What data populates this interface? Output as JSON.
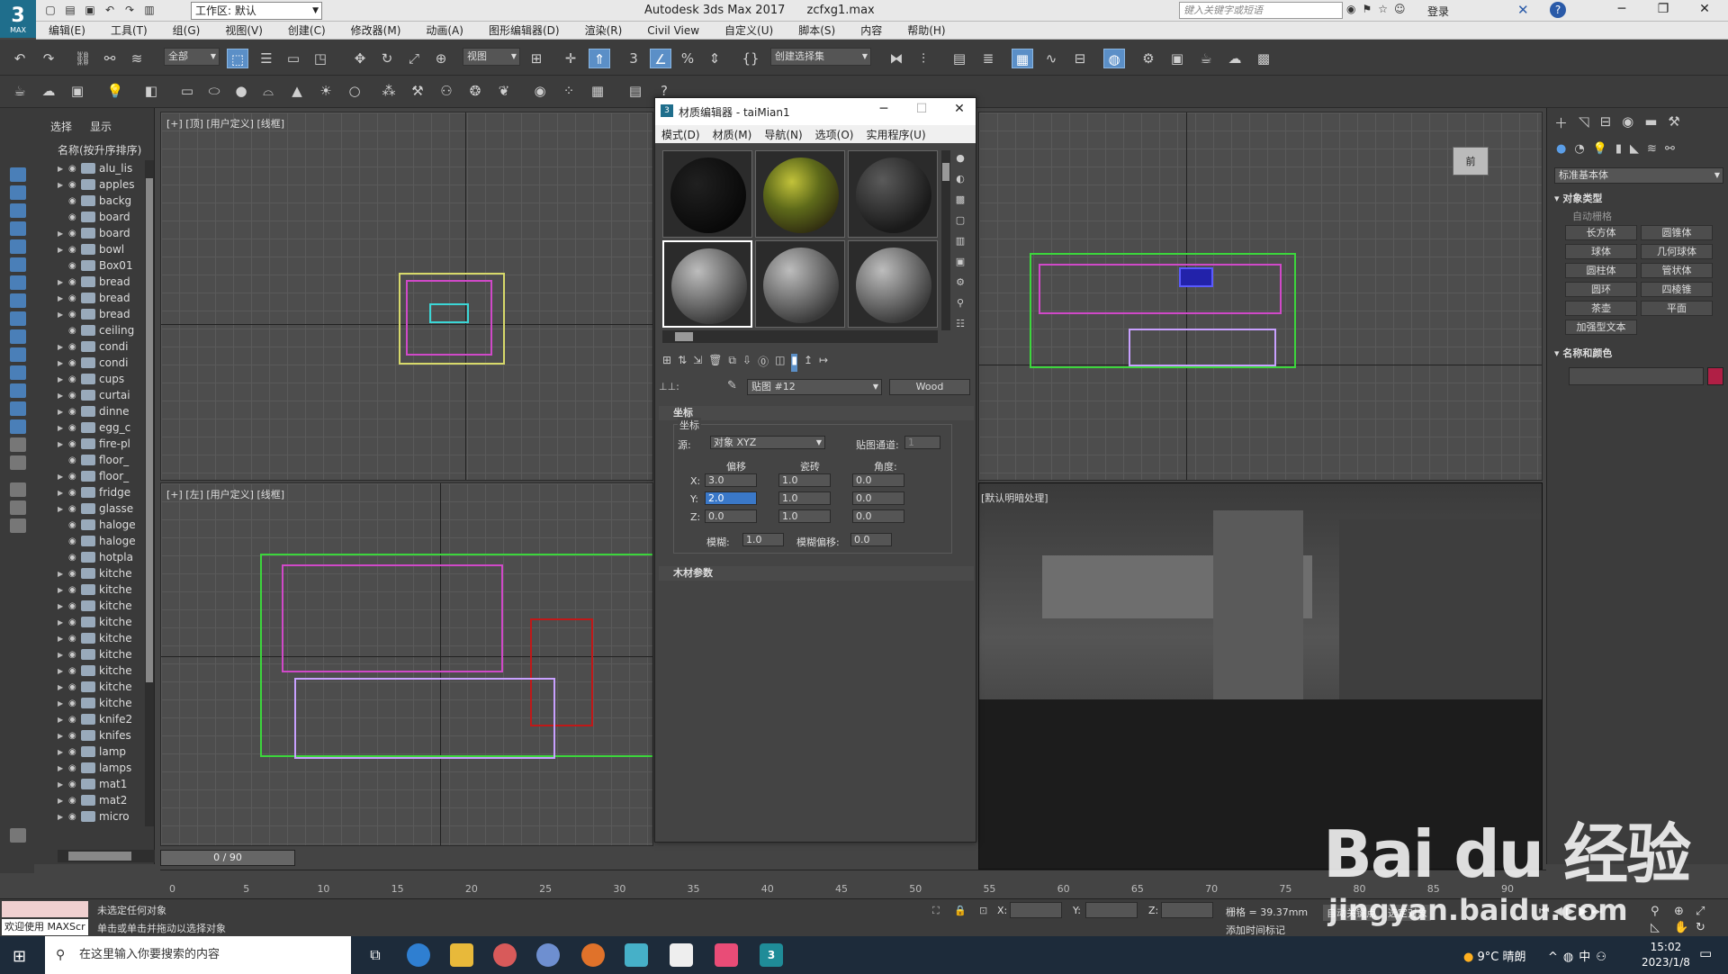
{
  "title_bar": {
    "workspace_label": "工作区: 默认",
    "app_title": "Autodesk 3ds Max 2017",
    "file_name": "zcfxg1.max",
    "search_placeholder": "键入关键字或短语",
    "login_label": "登录"
  },
  "app_logo": {
    "big": "3",
    "small": "MAX"
  },
  "menu": [
    "编辑(E)",
    "工具(T)",
    "组(G)",
    "视图(V)",
    "创建(C)",
    "修改器(M)",
    "动画(A)",
    "图形编辑器(D)",
    "渲染(R)",
    "Civil View",
    "自定义(U)",
    "脚本(S)",
    "内容",
    "帮助(H)"
  ],
  "toolbar": {
    "filter_label": "全部",
    "view_label": "视图",
    "selection_set_label": "创建选择集"
  },
  "scene_explorer": {
    "tabs": [
      "选择",
      "显示"
    ],
    "column_header": "名称(按升序排序)",
    "items": [
      "alu_lis",
      "apples",
      "backg",
      "board",
      "board",
      "bowl",
      "Box01",
      "bread",
      "bread",
      "bread",
      "ceiling",
      "condi",
      "condi",
      "cups",
      "curtai",
      "dinne",
      "egg_c",
      "fire-pl",
      "floor_",
      "floor_",
      "fridge",
      "glasse",
      "haloge",
      "haloge",
      "hotpla",
      "kitche",
      "kitche",
      "kitche",
      "kitche",
      "kitche",
      "kitche",
      "kitche",
      "kitche",
      "kitche",
      "knife2",
      "knifes",
      "lamp",
      "lamps",
      "mat1",
      "mat2",
      "micro"
    ]
  },
  "viewports": {
    "top": "[+] [顶] [用户定义] [线框]",
    "left": "[+] [左] [用户定义] [线框]",
    "camera": "[默认明暗处理]",
    "viewcube": "前"
  },
  "material_editor": {
    "title": "材质编辑器 - taiMian1",
    "menu": [
      "模式(D)",
      "材质(M)",
      "导航(N)",
      "选项(O)",
      "实用程序(U)"
    ],
    "map_name": "贴图 #12",
    "map_type": "Wood",
    "rollout_coords": "坐标",
    "group_label": "坐标",
    "source_label": "源:",
    "source_value": "对象 XYZ",
    "map_channel_label": "贴图通道:",
    "map_channel_value": "1",
    "col_offset": "偏移",
    "col_tiling": "瓷砖",
    "col_angle": "角度:",
    "rows": [
      {
        "axis": "X:",
        "offset": "3.0",
        "tiling": "1.0",
        "angle": "0.0"
      },
      {
        "axis": "Y:",
        "offset": "2.0",
        "tiling": "1.0",
        "angle": "0.0"
      },
      {
        "axis": "Z:",
        "offset": "0.0",
        "tiling": "1.0",
        "angle": "0.0"
      }
    ],
    "blur_label": "模糊:",
    "blur_value": "1.0",
    "blur_offset_label": "模糊偏移:",
    "blur_offset_value": "0.0",
    "rollout_wood": "木材参数"
  },
  "command_panel": {
    "dropdown": "标准基本体",
    "section_object_type": "对象类型",
    "autogrid": "自动栅格",
    "buttons": [
      "长方体",
      "圆锥体",
      "球体",
      "几何球体",
      "圆柱体",
      "管状体",
      "圆环",
      "四棱锥",
      "茶壶",
      "平面",
      "加强型文本"
    ],
    "section_name_color": "名称和颜色",
    "swatch_color": "#b01f45"
  },
  "timeline": {
    "slider_label": "0 / 90",
    "ticks": [
      "0",
      "5",
      "10",
      "15",
      "20",
      "25",
      "30",
      "35",
      "40",
      "45",
      "50",
      "55",
      "60",
      "65",
      "70",
      "75",
      "80",
      "85",
      "90"
    ]
  },
  "status": {
    "maxscript_label": "欢迎使用 MAXScr",
    "line1": "未选定任何对象",
    "line2": "单击或单击并拖动以选择对象",
    "x_label": "X:",
    "y_label": "Y:",
    "z_label": "Z:",
    "grid_label": "栅格 = 39.37mm",
    "add_time_tag": "添加时间标记",
    "auto_key": "自动关键点",
    "set_key": "选定对象"
  },
  "taskbar": {
    "search_placeholder": "在这里输入你要搜索的内容",
    "weather": "9°C 晴朗",
    "ime": "中",
    "time": "15:02",
    "date": "2023/1/8"
  },
  "watermark": {
    "brand": "Bai du 经验",
    "url": "jingyan.baidu.com"
  }
}
